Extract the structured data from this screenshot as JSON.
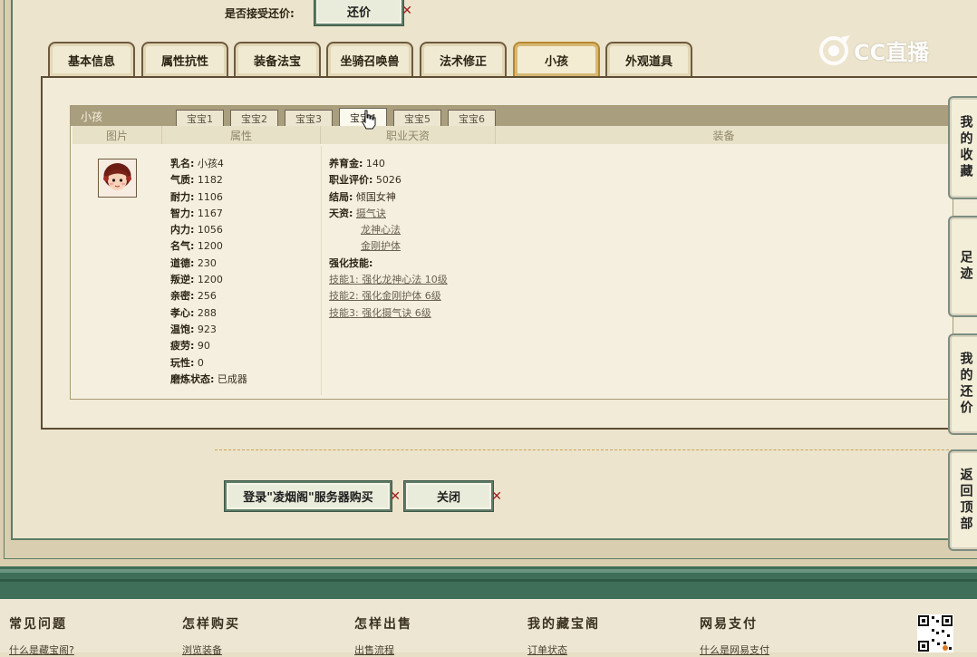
{
  "header": {
    "accept_counteroffer_label": "是否接受还价:",
    "counteroffer_button": "还价"
  },
  "tabs": [
    {
      "label": "基本信息",
      "active": false
    },
    {
      "label": "属性抗性",
      "active": false
    },
    {
      "label": "装备法宝",
      "active": false
    },
    {
      "label": "坐骑召唤兽",
      "active": false
    },
    {
      "label": "法术修正",
      "active": false
    },
    {
      "label": "小孩",
      "active": true
    },
    {
      "label": "外观道具",
      "active": false
    }
  ],
  "child_panel": {
    "title": "小孩",
    "subtabs": [
      {
        "label": "宝宝1",
        "active": false
      },
      {
        "label": "宝宝2",
        "active": false
      },
      {
        "label": "宝宝3",
        "active": false
      },
      {
        "label": "宝宝4",
        "active": true
      },
      {
        "label": "宝宝5",
        "active": false
      },
      {
        "label": "宝宝6",
        "active": false
      }
    ],
    "columns": [
      "图片",
      "属性",
      "职业天资",
      "装备"
    ],
    "attributes": [
      {
        "label": "乳名:",
        "value": "小孩4"
      },
      {
        "label": "气质:",
        "value": "1182"
      },
      {
        "label": "耐力:",
        "value": "1106"
      },
      {
        "label": "智力:",
        "value": "1167"
      },
      {
        "label": "内力:",
        "value": "1056"
      },
      {
        "label": "名气:",
        "value": "1200"
      },
      {
        "label": "道德:",
        "value": "230"
      },
      {
        "label": "叛逆:",
        "value": "1200"
      },
      {
        "label": "亲密:",
        "value": "256"
      },
      {
        "label": "孝心:",
        "value": "288"
      },
      {
        "label": "温饱:",
        "value": "923"
      },
      {
        "label": "疲劳:",
        "value": "90"
      },
      {
        "label": "玩性:",
        "value": "0"
      },
      {
        "label": "磨炼状态:",
        "value": "已成器"
      }
    ],
    "career": {
      "fund_label": "养育金:",
      "fund_value": "140",
      "rating_label": "职业评价:",
      "rating_value": "5026",
      "ending_label": "结局:",
      "ending_value": "倾国女神",
      "talent_label": "天资:",
      "talents": [
        "摄气诀",
        "龙神心法",
        "金刚护体"
      ],
      "skills_label": "强化技能:",
      "skills": [
        "技能1: 强化龙神心法 10级",
        "技能2: 强化金刚护体 6级",
        "技能3: 强化摄气诀 6级"
      ]
    }
  },
  "actions": {
    "login_buy_button": "登录\"凌烟阁\"服务器购买",
    "close_button": "关闭"
  },
  "side_nav": [
    "我的收藏",
    "足迹",
    "我的还价",
    "返回顶部"
  ],
  "footer": [
    {
      "title": "常见问题",
      "link": "什么是藏宝阁?"
    },
    {
      "title": "怎样购买",
      "link": "浏览装备"
    },
    {
      "title": "怎样出售",
      "link": "出售流程"
    },
    {
      "title": "我的藏宝阁",
      "link": "订单状态"
    },
    {
      "title": "网易支付",
      "link": "什么是网易支付"
    }
  ],
  "watermark": "CC直播",
  "colors": {
    "frame_green": "#5e7d68",
    "active_tab_gold": "#b8872e",
    "footer_band": "#3f6f58"
  }
}
